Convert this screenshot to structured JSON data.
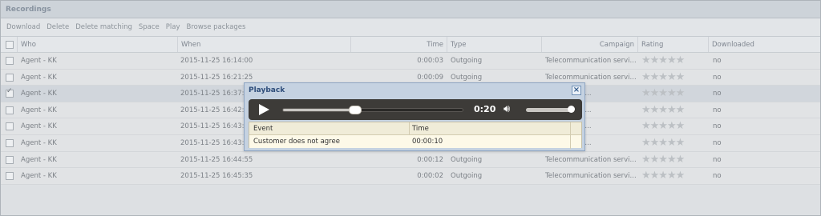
{
  "panel": {
    "title": "Recordings"
  },
  "toolbar": [
    "Download",
    "Delete",
    "Delete matching",
    "Space",
    "Play",
    "Browse packages"
  ],
  "columns": {
    "who": "Who",
    "when": "When",
    "time": "Time",
    "type": "Type",
    "campaign": "Campaign",
    "rating": "Rating",
    "downloaded": "Downloaded"
  },
  "rows": [
    {
      "who": "Agent - KK",
      "when": "2015-11-25 16:14:00",
      "time": "0:00:03",
      "type": "Outgoing",
      "campaign": "Telecommunication servi...",
      "rating": 0,
      "downloaded": "no",
      "checked": false
    },
    {
      "who": "Agent - KK",
      "when": "2015-11-25 16:21:25",
      "time": "0:00:09",
      "type": "Outgoing",
      "campaign": "Telecommunication servi...",
      "rating": 0,
      "downloaded": "no",
      "checked": false
    },
    {
      "who": "Agent - KK",
      "when": "2015-11-25 16:37:3",
      "time": "",
      "type": "",
      "campaign": "cation servi...",
      "rating": 0,
      "downloaded": "no",
      "checked": true
    },
    {
      "who": "Agent - KK",
      "when": "2015-11-25 16:42:2",
      "time": "",
      "type": "",
      "campaign": "cation servi...",
      "rating": 0,
      "downloaded": "no",
      "checked": false
    },
    {
      "who": "Agent - KK",
      "when": "2015-11-25 16:43:0",
      "time": "",
      "type": "",
      "campaign": "cation servi...",
      "rating": 0,
      "downloaded": "no",
      "checked": false
    },
    {
      "who": "Agent - KK",
      "when": "2015-11-25 16:43:4",
      "time": "",
      "type": "",
      "campaign": "cation servi...",
      "rating": 0,
      "downloaded": "no",
      "checked": false
    },
    {
      "who": "Agent - KK",
      "when": "2015-11-25 16:44:55",
      "time": "0:00:12",
      "type": "Outgoing",
      "campaign": "Telecommunication servi...",
      "rating": 0,
      "downloaded": "no",
      "checked": false
    },
    {
      "who": "Agent - KK",
      "when": "2015-11-25 16:45:35",
      "time": "0:00:02",
      "type": "Outgoing",
      "campaign": "Telecommunication servi...",
      "rating": 0,
      "downloaded": "no",
      "checked": false
    }
  ],
  "playback": {
    "title": "Playback",
    "close_icon": "close-icon",
    "time": "0:20",
    "progress": 0.4,
    "volume": 1.0,
    "events_header": {
      "event": "Event",
      "time": "Time"
    },
    "events": [
      {
        "event": "Customer does not agree",
        "time": "00:00:10"
      }
    ]
  }
}
